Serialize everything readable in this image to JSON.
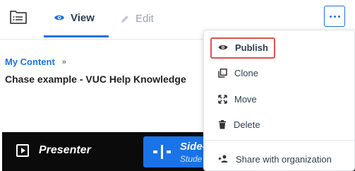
{
  "tabs": {
    "view_label": "View",
    "edit_label": "Edit"
  },
  "breadcrumb": {
    "root_label": "My Content",
    "separator": "»"
  },
  "page": {
    "title": "Chase example - VUC Help Knowledge"
  },
  "presenter": {
    "label": "Presenter",
    "side_title": "Side-",
    "side_subtitle": "Stude"
  },
  "menu": {
    "items": [
      {
        "label": "Publish",
        "icon": "eye-icon"
      },
      {
        "label": "Clone",
        "icon": "clone-icon"
      },
      {
        "label": "Move",
        "icon": "move-icon"
      },
      {
        "label": "Delete",
        "icon": "trash-icon"
      },
      {
        "label": "Share with organization",
        "icon": "share-users-icon"
      }
    ]
  },
  "colors": {
    "accent": "#1a73e8",
    "highlight_outline": "#d9534f",
    "presenter_bg": "#0b0b0b"
  }
}
